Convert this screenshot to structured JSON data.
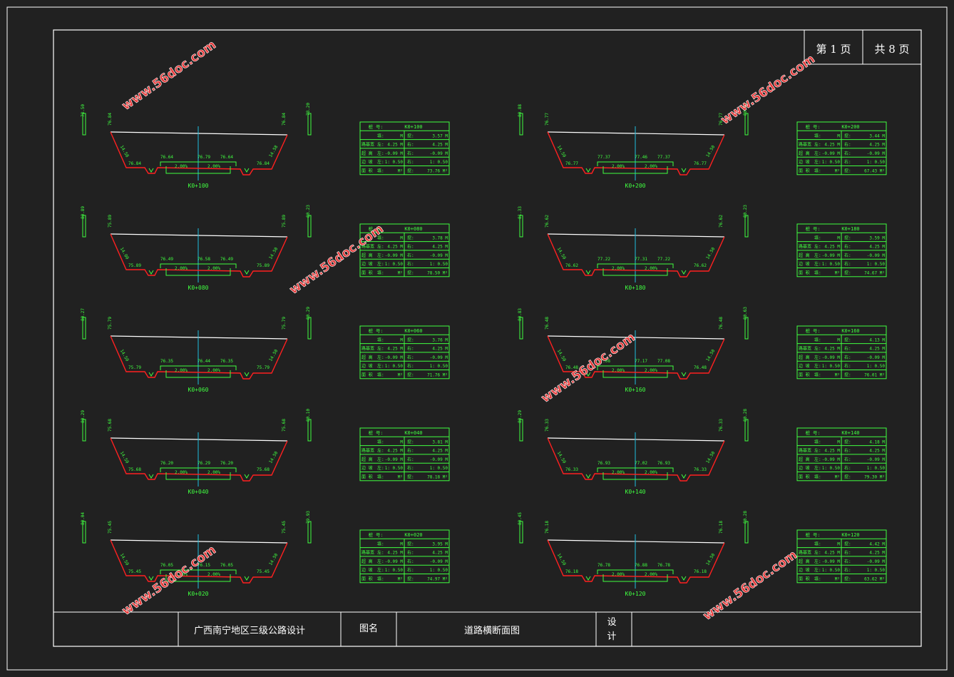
{
  "header": {
    "page_current": "第 1 页",
    "page_total": "共 8 页"
  },
  "title_block": {
    "project": "广西南宁地区三级公路设计",
    "drawing_label": "图名",
    "drawing_name": "道路横断面图",
    "design_label": "设计"
  },
  "watermark": "www.56doc.com",
  "colors": {
    "ground": "#ffffff",
    "cut": "#ff2020",
    "design": "#40ff40",
    "centerline": "#20c0e0",
    "table": "#40ff40",
    "frame": "#ffffff",
    "background": "#212121"
  },
  "sections": [
    {
      "station": "K0+100",
      "left_elev": "76.84",
      "cl_left": "76.64",
      "cl": "76.79",
      "cl_right": "76.64",
      "right_elev": "76.84",
      "left_slope": "14.58",
      "right_slope": "14.58",
      "left_h": "78.50",
      "right_h": "78.20",
      "grade_l": "2.00%",
      "grade_r": "2.00%",
      "table": {
        "title_k": "桩 号:",
        "title_v": "K0+100",
        "r1_l": "填:",
        "r1_lv": "M",
        "r1_r": "挖:",
        "r1_rv": "3.57 M",
        "r2_k": "路基宽",
        "r2_l": "左:",
        "r2_lv": "4.25 M",
        "r2_r": "右:",
        "r2_rv": "4.25 M",
        "r3_k": "超 高",
        "r3_l": "左:",
        "r3_lv": "-0.09 M",
        "r3_r": "右:",
        "r3_rv": "-0.09 M",
        "r4_k": "边 坡",
        "r4_l": "左:",
        "r4_lv": "1: 0.50",
        "r4_r": "右:",
        "r4_rv": "1: 0.50",
        "r5_k": "面 积",
        "r5_l": "填:",
        "r5_lv": "M²",
        "r5_r": "挖:",
        "r5_rv": "73.76 M²"
      }
    },
    {
      "station": "K0+080",
      "left_elev": "75.89",
      "cl_left": "76.49",
      "cl": "76.58",
      "cl_right": "76.49",
      "right_elev": "75.89",
      "left_slope": "14.00",
      "right_slope": "14.50",
      "left_h": "80.89",
      "right_h": "80.23",
      "grade_l": "2.00%",
      "grade_r": "2.00%",
      "table": {
        "title_k": "桩 号:",
        "title_v": "K0+080",
        "r1_l": "填:",
        "r1_lv": "M",
        "r1_r": "挖:",
        "r1_rv": "3.78 M",
        "r2_k": "路基宽",
        "r2_l": "左:",
        "r2_lv": "4.25 M",
        "r2_r": "右:",
        "r2_rv": "4.25 M",
        "r3_k": "超 高",
        "r3_l": "左:",
        "r3_lv": "-0.09 M",
        "r3_r": "右:",
        "r3_rv": "-0.09 M",
        "r4_k": "边 坡",
        "r4_l": "左:",
        "r4_lv": "1: 0.50",
        "r4_r": "右:",
        "r4_rv": "1: 0.50",
        "r5_k": "面 积",
        "r5_l": "填:",
        "r5_lv": "M²",
        "r5_r": "挖:",
        "r5_rv": "78.50 M²"
      }
    },
    {
      "station": "K0+060",
      "left_elev": "75.79",
      "cl_left": "76.35",
      "cl": "76.44",
      "cl_right": "76.35",
      "right_elev": "75.79",
      "left_slope": "14.50",
      "right_slope": "14.50",
      "left_h": "80.27",
      "right_h": "80.29",
      "grade_l": "2.00%",
      "grade_r": "2.00%",
      "table": {
        "title_k": "桩 号:",
        "title_v": "K0+060",
        "r1_l": "填:",
        "r1_lv": "M",
        "r1_r": "挖:",
        "r1_rv": "3.76 M",
        "r2_k": "路基宽",
        "r2_l": "左:",
        "r2_lv": "4.25 M",
        "r2_r": "右:",
        "r2_rv": "4.25 M",
        "r3_k": "超 高",
        "r3_l": "左:",
        "r3_lv": "-0.09 M",
        "r3_r": "右:",
        "r3_rv": "-0.09 M",
        "r4_k": "边 坡",
        "r4_l": "左:",
        "r4_lv": "1: 0.50",
        "r4_r": "右:",
        "r4_rv": "1: 0.50",
        "r5_k": "面 积",
        "r5_l": "填:",
        "r5_lv": "M²",
        "r5_r": "挖:",
        "r5_rv": "71.76 M²"
      }
    },
    {
      "station": "K0+040",
      "left_elev": "75.68",
      "cl_left": "76.20",
      "cl": "76.29",
      "cl_right": "76.20",
      "right_elev": "75.68",
      "left_slope": "14.50",
      "right_slope": "14.50",
      "left_h": "80.29",
      "right_h": "80.10",
      "grade_l": "2.00%",
      "grade_r": "2.00%",
      "table": {
        "title_k": "桩 号:",
        "title_v": "K0+040",
        "r1_l": "填:",
        "r1_lv": "M",
        "r1_r": "挖:",
        "r1_rv": "3.81 M",
        "r2_k": "路基宽",
        "r2_l": "左:",
        "r2_lv": "4.25 M",
        "r2_r": "右:",
        "r2_rv": "4.25 M",
        "r3_k": "超 高",
        "r3_l": "左:",
        "r3_lv": "-0.09 M",
        "r3_r": "右:",
        "r3_rv": "-0.09 M",
        "r4_k": "边 坡",
        "r4_l": "左:",
        "r4_lv": "1: 0.50",
        "r4_r": "右:",
        "r4_rv": "1: 0.50",
        "r5_k": "面 积",
        "r5_l": "填:",
        "r5_lv": "M²",
        "r5_r": "挖:",
        "r5_rv": "78.18 M²"
      }
    },
    {
      "station": "K0+020",
      "left_elev": "75.45",
      "cl_left": "76.05",
      "cl": "76.15",
      "cl_right": "76.05",
      "right_elev": "75.45",
      "left_slope": "14.50",
      "right_slope": "14.50",
      "left_h": "80.04",
      "right_h": "79.93",
      "grade_l": "2.00%",
      "grade_r": "2.00%",
      "table": {
        "title_k": "桩 号:",
        "title_v": "K0+020",
        "r1_l": "填:",
        "r1_lv": "M",
        "r1_r": "挖:",
        "r1_rv": "3.95 M",
        "r2_k": "路基宽",
        "r2_l": "左:",
        "r2_lv": "4.25 M",
        "r2_r": "右:",
        "r2_rv": "4.25 M",
        "r3_k": "超 高",
        "r3_l": "左:",
        "r3_lv": "-0.09 M",
        "r3_r": "右:",
        "r3_rv": "-0.09 M",
        "r4_k": "边 坡",
        "r4_l": "左:",
        "r4_lv": "1: 0.50",
        "r4_r": "右:",
        "r4_rv": "1: 0.50",
        "r5_k": "面 积",
        "r5_l": "填:",
        "r5_lv": "M²",
        "r5_r": "挖:",
        "r5_rv": "74.97 M²"
      }
    },
    {
      "station": "K0+200",
      "left_elev": "76.77",
      "cl_left": "77.37",
      "cl": "77.46",
      "cl_right": "77.37",
      "right_elev": "76.77",
      "left_slope": "14.50",
      "right_slope": "14.50",
      "left_h": "80.88",
      "right_h": "80.09",
      "grade_l": "2.00%",
      "grade_r": "2.00%",
      "table": {
        "title_k": "桩 号:",
        "title_v": "K0+200",
        "r1_l": "填:",
        "r1_lv": "M",
        "r1_r": "挖:",
        "r1_rv": "3.44 M",
        "r2_k": "路基宽",
        "r2_l": "左:",
        "r2_lv": "4.25 M",
        "r2_r": "右:",
        "r2_rv": "4.25 M",
        "r3_k": "超 高",
        "r3_l": "左:",
        "r3_lv": "-0.09 M",
        "r3_r": "右:",
        "r3_rv": "-0.09 M",
        "r4_k": "边 坡",
        "r4_l": "左:",
        "r4_lv": "1: 0.50",
        "r4_r": "右:",
        "r4_rv": "1: 0.50",
        "r5_k": "面 积",
        "r5_l": "填:",
        "r5_lv": "M²",
        "r5_r": "挖:",
        "r5_rv": "67.43 M²"
      }
    },
    {
      "station": "K0+180",
      "left_elev": "76.62",
      "cl_left": "77.22",
      "cl": "77.31",
      "cl_right": "77.22",
      "right_elev": "76.62",
      "left_slope": "14.50",
      "right_slope": "14.50",
      "left_h": "81.33",
      "right_h": "80.23",
      "grade_l": "2.00%",
      "grade_r": "2.00%",
      "table": {
        "title_k": "桩 号:",
        "title_v": "K0+180",
        "r1_l": "填:",
        "r1_lv": "M",
        "r1_r": "挖:",
        "r1_rv": "3.59 M",
        "r2_k": "路基宽",
        "r2_l": "左:",
        "r2_lv": "4.25 M",
        "r2_r": "右:",
        "r2_rv": "4.25 M",
        "r3_k": "超 高",
        "r3_l": "左:",
        "r3_lv": "-0.09 M",
        "r3_r": "右:",
        "r3_rv": "-0.09 M",
        "r4_k": "边 坡",
        "r4_l": "左:",
        "r4_lv": "1: 0.50",
        "r4_r": "右:",
        "r4_rv": "1: 0.50",
        "r5_k": "面 积",
        "r5_l": "填:",
        "r5_lv": "M²",
        "r5_r": "挖:",
        "r5_rv": "74.67 M²"
      }
    },
    {
      "station": "K0+160",
      "left_elev": "76.48",
      "cl_left": "77.08",
      "cl": "77.17",
      "cl_right": "77.08",
      "right_elev": "76.48",
      "left_slope": "14.50",
      "right_slope": "14.50",
      "left_h": "80.83",
      "right_h": "80.63",
      "grade_l": "2.00%",
      "grade_r": "2.00%",
      "table": {
        "title_k": "桩 号:",
        "title_v": "K0+160",
        "r1_l": "填:",
        "r1_lv": "M",
        "r1_r": "挖:",
        "r1_rv": "4.13 M",
        "r2_k": "路基宽",
        "r2_l": "左:",
        "r2_lv": "4.25 M",
        "r2_r": "右:",
        "r2_rv": "4.25 M",
        "r3_k": "超 高",
        "r3_l": "左:",
        "r3_lv": "-0.09 M",
        "r3_r": "右:",
        "r3_rv": "-0.09 M",
        "r4_k": "边 坡",
        "r4_l": "左:",
        "r4_lv": "1: 0.50",
        "r4_r": "右:",
        "r4_rv": "1: 0.50",
        "r5_k": "面 积",
        "r5_l": "填:",
        "r5_lv": "M²",
        "r5_r": "挖:",
        "r5_rv": "76.01 M²"
      }
    },
    {
      "station": "K0+140",
      "left_elev": "76.33",
      "cl_left": "76.93",
      "cl": "77.02",
      "cl_right": "76.93",
      "right_elev": "76.33",
      "left_slope": "14.50",
      "right_slope": "14.50",
      "left_h": "80.29",
      "right_h": "80.28",
      "grade_l": "2.00%",
      "grade_r": "2.00%",
      "table": {
        "title_k": "桩 号:",
        "title_v": "K0+140",
        "r1_l": "填:",
        "r1_lv": "M",
        "r1_r": "挖:",
        "r1_rv": "4.18 M",
        "r2_k": "路基宽",
        "r2_l": "左:",
        "r2_lv": "4.25 M",
        "r2_r": "右:",
        "r2_rv": "4.25 M",
        "r3_k": "超 高",
        "r3_l": "左:",
        "r3_lv": "-0.09 M",
        "r3_r": "右:",
        "r3_rv": "-0.09 M",
        "r4_k": "边 坡",
        "r4_l": "左:",
        "r4_lv": "1: 0.50",
        "r4_r": "右:",
        "r4_rv": "1: 0.50",
        "r5_k": "面 积",
        "r5_l": "填:",
        "r5_lv": "M²",
        "r5_r": "挖:",
        "r5_rv": "79.30 M²"
      }
    },
    {
      "station": "K0+120",
      "left_elev": "76.18",
      "cl_left": "76.78",
      "cl": "76.88",
      "cl_right": "76.78",
      "right_elev": "76.18",
      "left_slope": "14.50",
      "right_slope": "14.50",
      "left_h": "80.45",
      "right_h": "80.28",
      "grade_l": "2.00%",
      "grade_r": "2.00%",
      "table": {
        "title_k": "桩 号:",
        "title_v": "K0+120",
        "r1_l": "填:",
        "r1_lv": "M",
        "r1_r": "挖:",
        "r1_rv": "4.42 M",
        "r2_k": "路基宽",
        "r2_l": "左:",
        "r2_lv": "4.25 M",
        "r2_r": "右:",
        "r2_rv": "4.25 M",
        "r3_k": "超 高",
        "r3_l": "左:",
        "r3_lv": "-0.09 M",
        "r3_r": "右:",
        "r3_rv": "-0.09 M",
        "r4_k": "边 坡",
        "r4_l": "左:",
        "r4_lv": "1: 0.50",
        "r4_r": "右:",
        "r4_rv": "1: 0.50",
        "r5_k": "面 积",
        "r5_l": "填:",
        "r5_lv": "M²",
        "r5_r": "挖:",
        "r5_rv": "63.62 M²"
      }
    }
  ]
}
